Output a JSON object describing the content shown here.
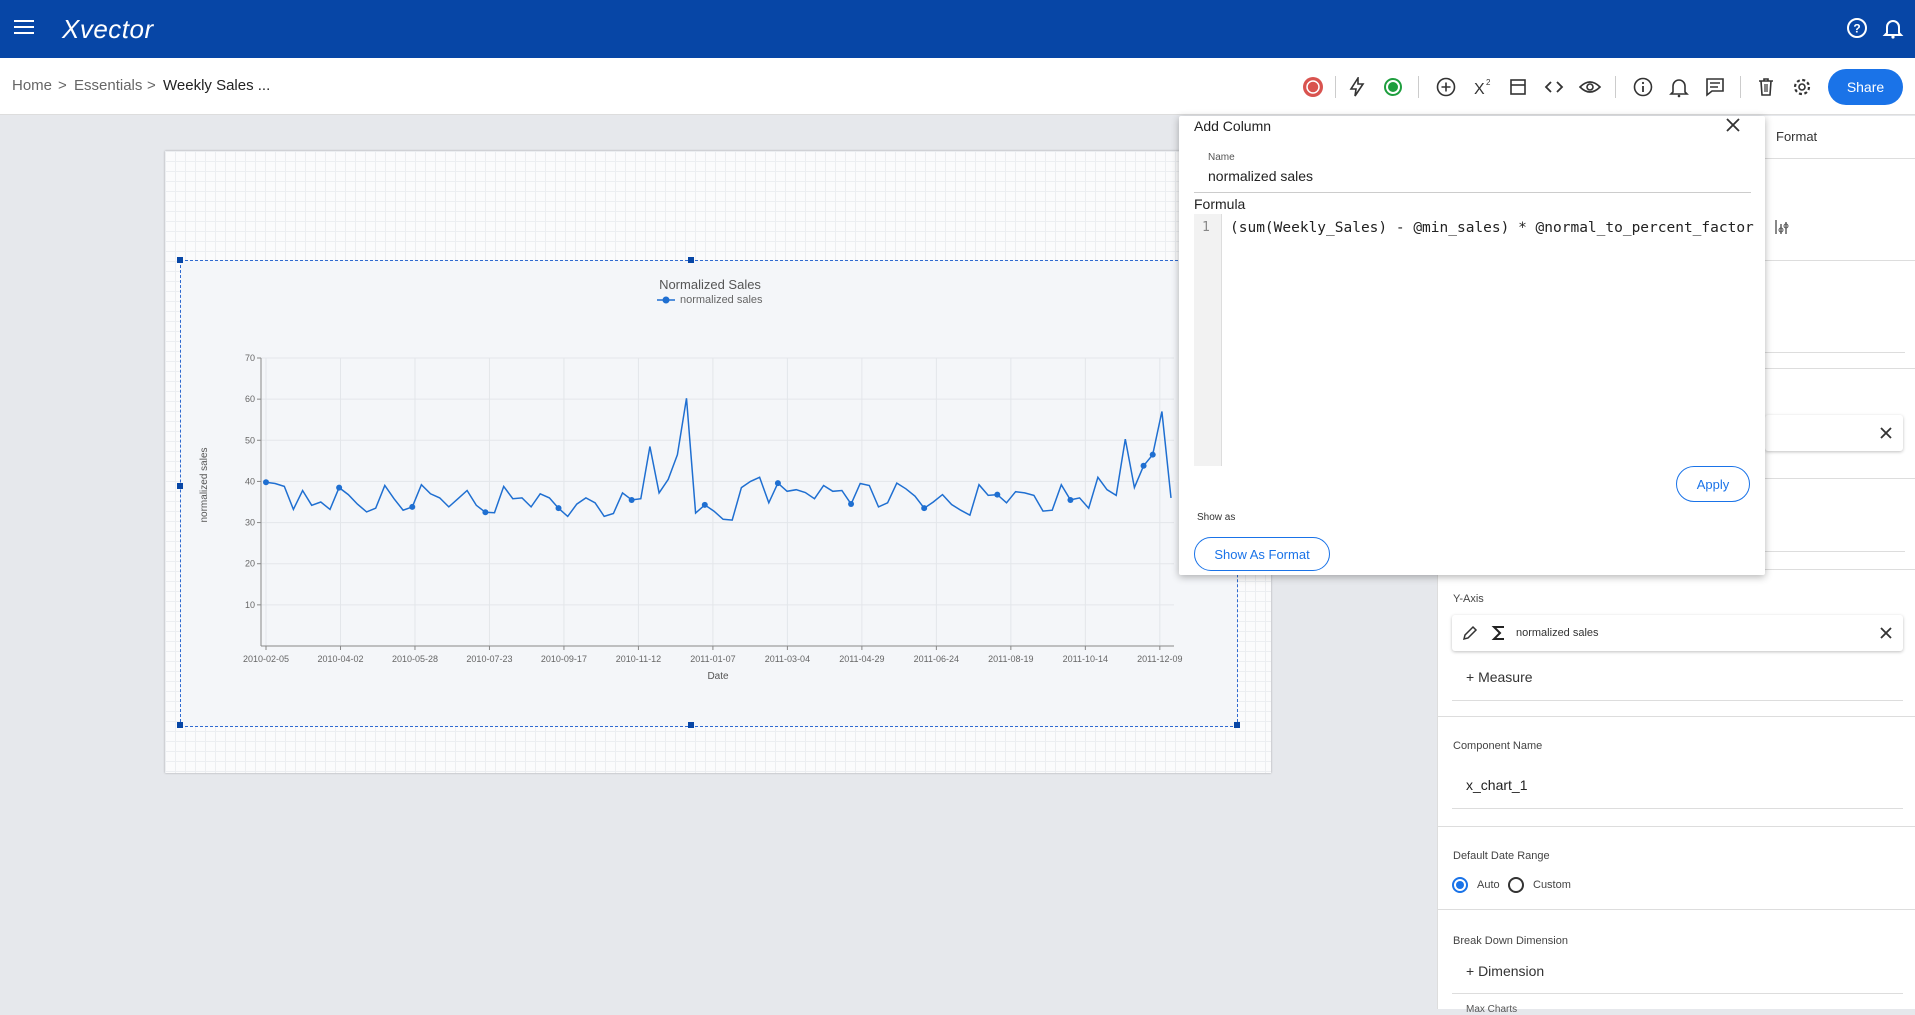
{
  "app": {
    "logo": "Xvector"
  },
  "breadcrumb": {
    "home": "Home",
    "sep1": ">",
    "essentials": "Essentials",
    "sep2": ">",
    "current": "Weekly Sales ..."
  },
  "toolbar": {
    "share_label": "Share"
  },
  "dialog": {
    "title": "Add Column",
    "name_label": "Name",
    "name_value": "normalized sales",
    "formula_label": "Formula",
    "line_number": "1",
    "formula": "(sum(Weekly_Sales) - @min_sales) * @normal_to_percent_factor",
    "apply_label": "Apply",
    "show_as_label": "Show as",
    "show_as_format_label": "Show As Format"
  },
  "right_panel": {
    "format_tab": "Format",
    "y_axis_label": "Y-Axis",
    "y_axis_measure": "normalized sales",
    "add_measure": "+ Measure",
    "component_name_label": "Component Name",
    "component_name_value": "x_chart_1",
    "date_range_label": "Default Date Range",
    "date_range_options": [
      "Auto",
      "Custom"
    ],
    "date_range_selected": "Auto",
    "breakdown_label": "Break Down Dimension",
    "add_dimension": "+ Dimension",
    "max_charts_label": "Max Charts"
  },
  "colors": {
    "brand": "#0746a6",
    "accent": "#1a73e8",
    "series": "#1f6fd1"
  },
  "chart_data": {
    "type": "line",
    "title": "Normalized Sales",
    "xlabel": "Date",
    "ylabel": "normalized sales",
    "ylim": [
      0,
      70
    ],
    "yticks": [
      10,
      20,
      30,
      40,
      50,
      60,
      70
    ],
    "xticks": [
      "2010-02-05",
      "2010-04-02",
      "2010-05-28",
      "2010-07-23",
      "2010-09-17",
      "2010-11-12",
      "2011-01-07",
      "2011-03-04",
      "2011-04-29",
      "2011-06-24",
      "2011-08-19",
      "2011-10-14",
      "2011-12-09"
    ],
    "legend": "top-center",
    "grid": true,
    "series": [
      {
        "name": "normalized sales",
        "values": [
          39.8,
          39.5,
          38.8,
          33.2,
          37.8,
          34.2,
          35.0,
          33.2,
          38.5,
          36.8,
          34.5,
          32.6,
          33.5,
          39.0,
          35.8,
          33.0,
          33.8,
          39.2,
          37.0,
          36.0,
          33.8,
          35.8,
          37.8,
          34.2,
          32.5,
          32.4,
          38.8,
          35.8,
          36.0,
          33.8,
          37.0,
          36.0,
          33.5,
          31.5,
          34.5,
          36.0,
          34.8,
          31.5,
          32.2,
          37.2,
          35.5,
          35.8,
          48.5,
          37.2,
          40.5,
          46.5,
          60.2,
          32.3,
          34.3,
          32.8,
          30.8,
          30.6,
          38.5,
          40.0,
          41.0,
          34.8,
          39.6,
          37.6,
          38.0,
          37.3,
          35.8,
          39.0,
          37.6,
          37.8,
          34.5,
          39.5,
          39.0,
          33.8,
          34.8,
          39.6,
          38.2,
          36.4,
          33.5,
          35.0,
          36.8,
          34.4,
          33.0,
          31.8,
          39.2,
          36.6,
          36.8,
          34.8,
          37.5,
          37.2,
          36.6,
          32.8,
          33.0,
          39.2,
          35.5,
          36.0,
          33.5,
          41.0,
          38.0,
          36.6,
          50.3,
          38.5,
          43.8,
          46.5,
          57.0,
          36.0
        ]
      }
    ]
  }
}
